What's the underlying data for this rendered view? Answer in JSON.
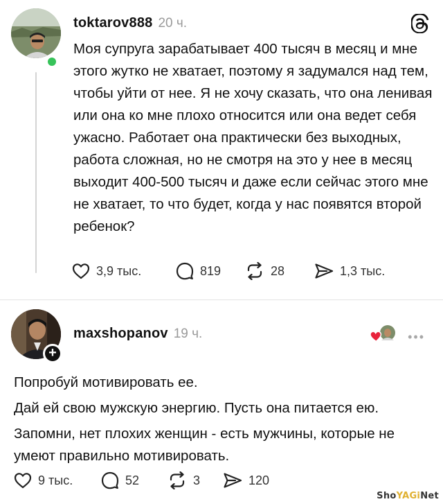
{
  "post1": {
    "username": "toktarov888",
    "time": "20 ч.",
    "text": "Моя супруга зарабатывает 400 тысяч в месяц и мне этого жутко не хватает, поэтому я задумался над тем, чтобы уйти от нее. Я не хочу сказать, что она ленивая или она ко мне плохо относится или она ведет себя ужасно. Работает она практически без выходных, работа сложная, но не смотря на это у нее в месяц выходит 400-500 тысяч и даже если сейчас этого мне не хватает, то что будет, когда у нас появятся второй ребенок?",
    "likes": "3,9 тыс.",
    "comments": "819",
    "reposts": "28",
    "shares": "1,3 тыс."
  },
  "post2": {
    "username": "maxshopanov",
    "time": "19 ч.",
    "paragraphs": [
      "Попробуй мотивировать ее.",
      "Дай ей свою мужскую энергию. Пусть она питается ею.",
      "Запомни, нет плохих женщин - есть мужчины, которые не умеют правильно мотивировать."
    ],
    "likes": "9 тыс.",
    "comments": "52",
    "reposts": "3",
    "shares": "120"
  },
  "more_menu": "•••",
  "watermark": {
    "part1": "Sho",
    "part2": "YAGi",
    "part3": "Net"
  },
  "colors": {
    "online": "#37c35a",
    "heart": "#e8243c",
    "muted": "#9a9a9a"
  },
  "icons": [
    "heart-icon",
    "comment-icon",
    "repost-icon",
    "share-icon",
    "threads-logo-icon",
    "plus-icon"
  ]
}
